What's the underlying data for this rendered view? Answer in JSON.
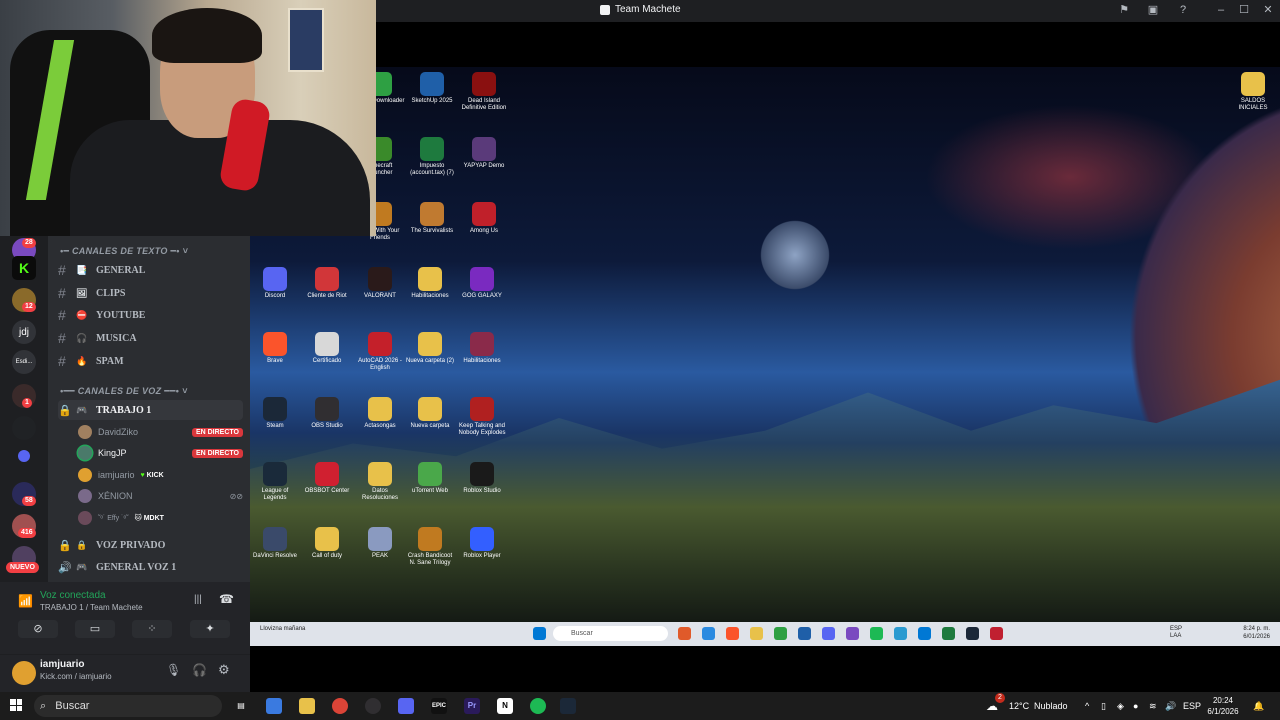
{
  "window": {
    "title": "Team Machete"
  },
  "servers": {
    "badges": [
      "28",
      "12",
      "1",
      "58",
      "416"
    ],
    "labels": [
      "jdj",
      "Esdi..."
    ],
    "nuevo": "NUEVO"
  },
  "channels": {
    "text_category": "CANALES DE TEXTO",
    "text": [
      {
        "emoji": "📑",
        "name": "GENERAL"
      },
      {
        "emoji": "🖼",
        "name": "CLIPS"
      },
      {
        "emoji": "⛔",
        "name": "YOUTUBE"
      },
      {
        "emoji": "🎧",
        "name": "MUSICA"
      },
      {
        "emoji": "🔥",
        "name": "SPAM"
      }
    ],
    "voice_category": "CANALES DE VOZ",
    "voice_active": {
      "emoji": "🎮",
      "name": "TRABAJO 1"
    },
    "voice_users": [
      {
        "name": "DavidZiko",
        "badge": "EN DIRECTO"
      },
      {
        "name": "KingJP",
        "badge": "EN DIRECTO"
      },
      {
        "name": "iamjuario",
        "tag": "KICK"
      },
      {
        "name": "XÉNION"
      },
      {
        "name": "˜ᵒ˙ Effy ˙ᵒ˜",
        "tag": "MDKT"
      }
    ],
    "voice_other": [
      {
        "emoji": "🔒",
        "name": "VOZ PRIVADO"
      },
      {
        "emoji": "🎮",
        "name": "GENERAL VOZ 1"
      }
    ]
  },
  "voice_panel": {
    "status": "Voz conectada",
    "channel": "TRABAJO 1 / Team Machete"
  },
  "user_panel": {
    "username": "iamjuario",
    "status": "Kick.com / iamjuario"
  },
  "desktop_icons": [
    {
      "label": "Video Downloader",
      "color": "#2ea043"
    },
    {
      "label": "SketchUp 2025",
      "color": "#1f5fa8"
    },
    {
      "label": "Dead Island Definitive Edition",
      "color": "#8a1010"
    },
    {
      "label": "Minecraft Launcher",
      "color": "#3a8a2a"
    },
    {
      "label": "Impuesto (account.tax) (7)",
      "color": "#1e7a3e"
    },
    {
      "label": "YAPYAP Demo",
      "color": "#5a3a7a"
    },
    {
      "label": "Fish With Your Friends",
      "color": "#c07a20"
    },
    {
      "label": "The Survivalists",
      "color": "#c07a30"
    },
    {
      "label": "Among Us",
      "color": "#c0202a"
    },
    {
      "label": "Discord",
      "color": "#5865f2"
    },
    {
      "label": "Cliente de Riot",
      "color": "#d13639"
    },
    {
      "label": "VALORANT",
      "color": "#2a1a1a"
    },
    {
      "label": "Habilitaciones",
      "color": "#e8c14a"
    },
    {
      "label": "GOG GALAXY",
      "color": "#7a2ac0"
    },
    {
      "label": "Brave",
      "color": "#fb542b"
    },
    {
      "label": "Certificado",
      "color": "#d8d8d8"
    },
    {
      "label": "AutoCAD 2026 - English",
      "color": "#c4202a"
    },
    {
      "label": "Nueva carpeta (2)",
      "color": "#e8c14a"
    },
    {
      "label": "Habilitaciones",
      "color": "#8a2a4a"
    },
    {
      "label": "Steam",
      "color": "#1b2838"
    },
    {
      "label": "OBS Studio",
      "color": "#302e31"
    },
    {
      "label": "Actasongas",
      "color": "#e8c14a"
    },
    {
      "label": "Nueva carpeta",
      "color": "#e8c14a"
    },
    {
      "label": "Keep Talking and Nobody Explodes",
      "color": "#b02020"
    },
    {
      "label": "League of Legends",
      "color": "#1a2a3a"
    },
    {
      "label": "OBSBOT Center",
      "color": "#d02030"
    },
    {
      "label": "Datos Resoluciones",
      "color": "#e8c14a"
    },
    {
      "label": "uTorrent Web",
      "color": "#4aa84a"
    },
    {
      "label": "Roblox Studio",
      "color": "#1a1a1a"
    },
    {
      "label": "DaVinci Resolve",
      "color": "#3a4a6a"
    },
    {
      "label": "Call of duty",
      "color": "#e8c14a"
    },
    {
      "label": "PEAK",
      "color": "#8a9ac0"
    },
    {
      "label": "Crash Bandicoot N. Sane Trilogy",
      "color": "#c07a20"
    },
    {
      "label": "Roblox Player",
      "color": "#335fff"
    },
    {
      "label": "SALDOS INICIALES",
      "color": "#e8c14a"
    }
  ],
  "inner_taskbar": {
    "weather": "Llovizna mañana",
    "search": "Buscar",
    "lang": "ESP LAA",
    "time": "8:24 p. m.",
    "date": "6/01/2026"
  },
  "taskbar": {
    "search": "Buscar",
    "weather_temp": "12°C",
    "weather_desc": "Nublado",
    "lang": "ESP",
    "time": "20:24",
    "date": "6/1/2026",
    "weather_badge": "2"
  }
}
